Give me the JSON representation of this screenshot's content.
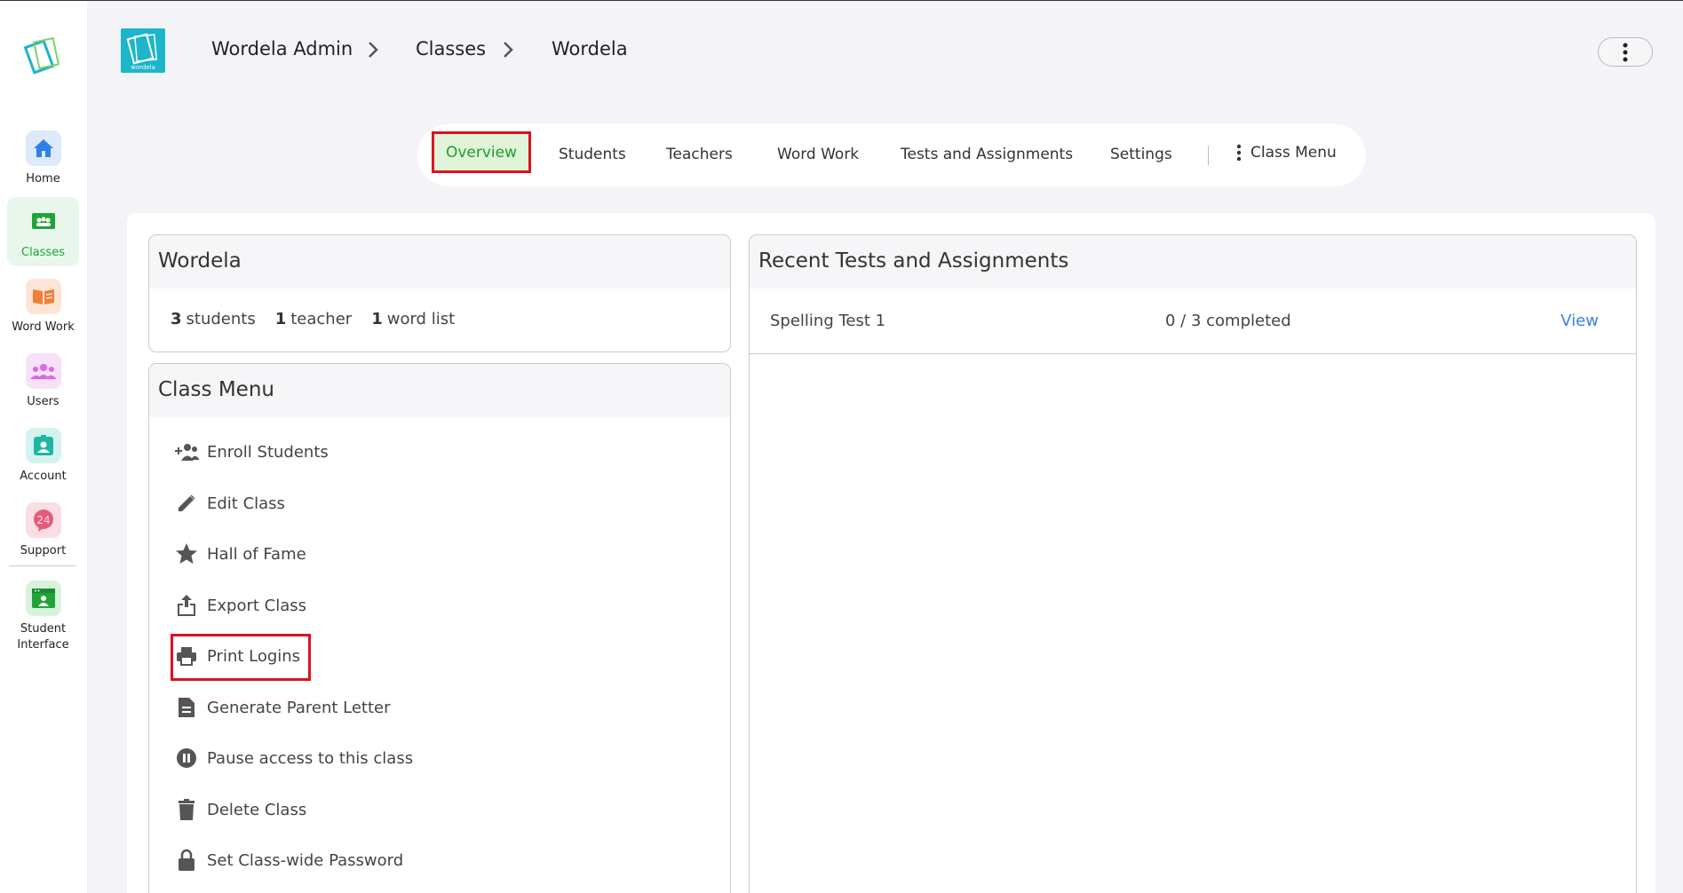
{
  "sidebar": {
    "items": [
      {
        "label": "Home",
        "icon": "home-icon",
        "color": "#2f80ed",
        "bg": "#dceaf9"
      },
      {
        "label": "Classes",
        "icon": "classes-icon",
        "color": "#22a33a",
        "bg": "#22a33a"
      },
      {
        "label": "Word Work",
        "icon": "book-icon",
        "color": "#f07f3c",
        "bg": "#fde5d6"
      },
      {
        "label": "Users",
        "icon": "users-icon",
        "color": "#d66be3",
        "bg": "#f7e1f9"
      },
      {
        "label": "Account",
        "icon": "account-icon",
        "color": "#1fb5a5",
        "bg": "#d3f3ef"
      },
      {
        "label": "Support",
        "icon": "support-icon",
        "color": "#e55a7a",
        "bg": "#fbdde4"
      },
      {
        "label": "Student Interface",
        "icon": "student-interface-icon",
        "color": "#22a33a",
        "bg": "#d8f3dc"
      }
    ],
    "active": "Classes"
  },
  "header": {
    "logo_text": "wordela",
    "breadcrumb": [
      "Wordela Admin",
      "Classes",
      "Wordela"
    ]
  },
  "tabs": {
    "items": [
      "Overview",
      "Students",
      "Teachers",
      "Word Work",
      "Tests and Assignments",
      "Settings"
    ],
    "active": "Overview",
    "class_menu": "Class Menu"
  },
  "class_card": {
    "title": "Wordela",
    "stats": [
      {
        "count": "3",
        "label": "students"
      },
      {
        "count": "1",
        "label": "teacher"
      },
      {
        "count": "1",
        "label": "word list"
      }
    ]
  },
  "class_menu": {
    "title": "Class Menu",
    "items": [
      {
        "label": "Enroll Students",
        "icon": "enroll-users-icon"
      },
      {
        "label": "Edit Class",
        "icon": "pencil-icon"
      },
      {
        "label": "Hall of Fame",
        "icon": "star-icon"
      },
      {
        "label": "Export Class",
        "icon": "export-icon"
      },
      {
        "label": "Print Logins",
        "icon": "printer-icon"
      },
      {
        "label": "Generate Parent Letter",
        "icon": "document-icon"
      },
      {
        "label": "Pause access to this class",
        "icon": "pause-icon"
      },
      {
        "label": "Delete Class",
        "icon": "trash-icon"
      },
      {
        "label": "Set Class-wide Password",
        "icon": "lock-icon"
      }
    ],
    "highlighted": "Print Logins"
  },
  "recent": {
    "title": "Recent Tests and Assignments",
    "rows": [
      {
        "name": "Spelling Test 1",
        "status": "0 / 3 completed",
        "action": "View"
      }
    ]
  },
  "colors": {
    "accent_green": "#22a33a",
    "highlight_red": "#d9141e",
    "link_blue": "#3b7fe0",
    "brand_teal": "#1cb5c9"
  }
}
